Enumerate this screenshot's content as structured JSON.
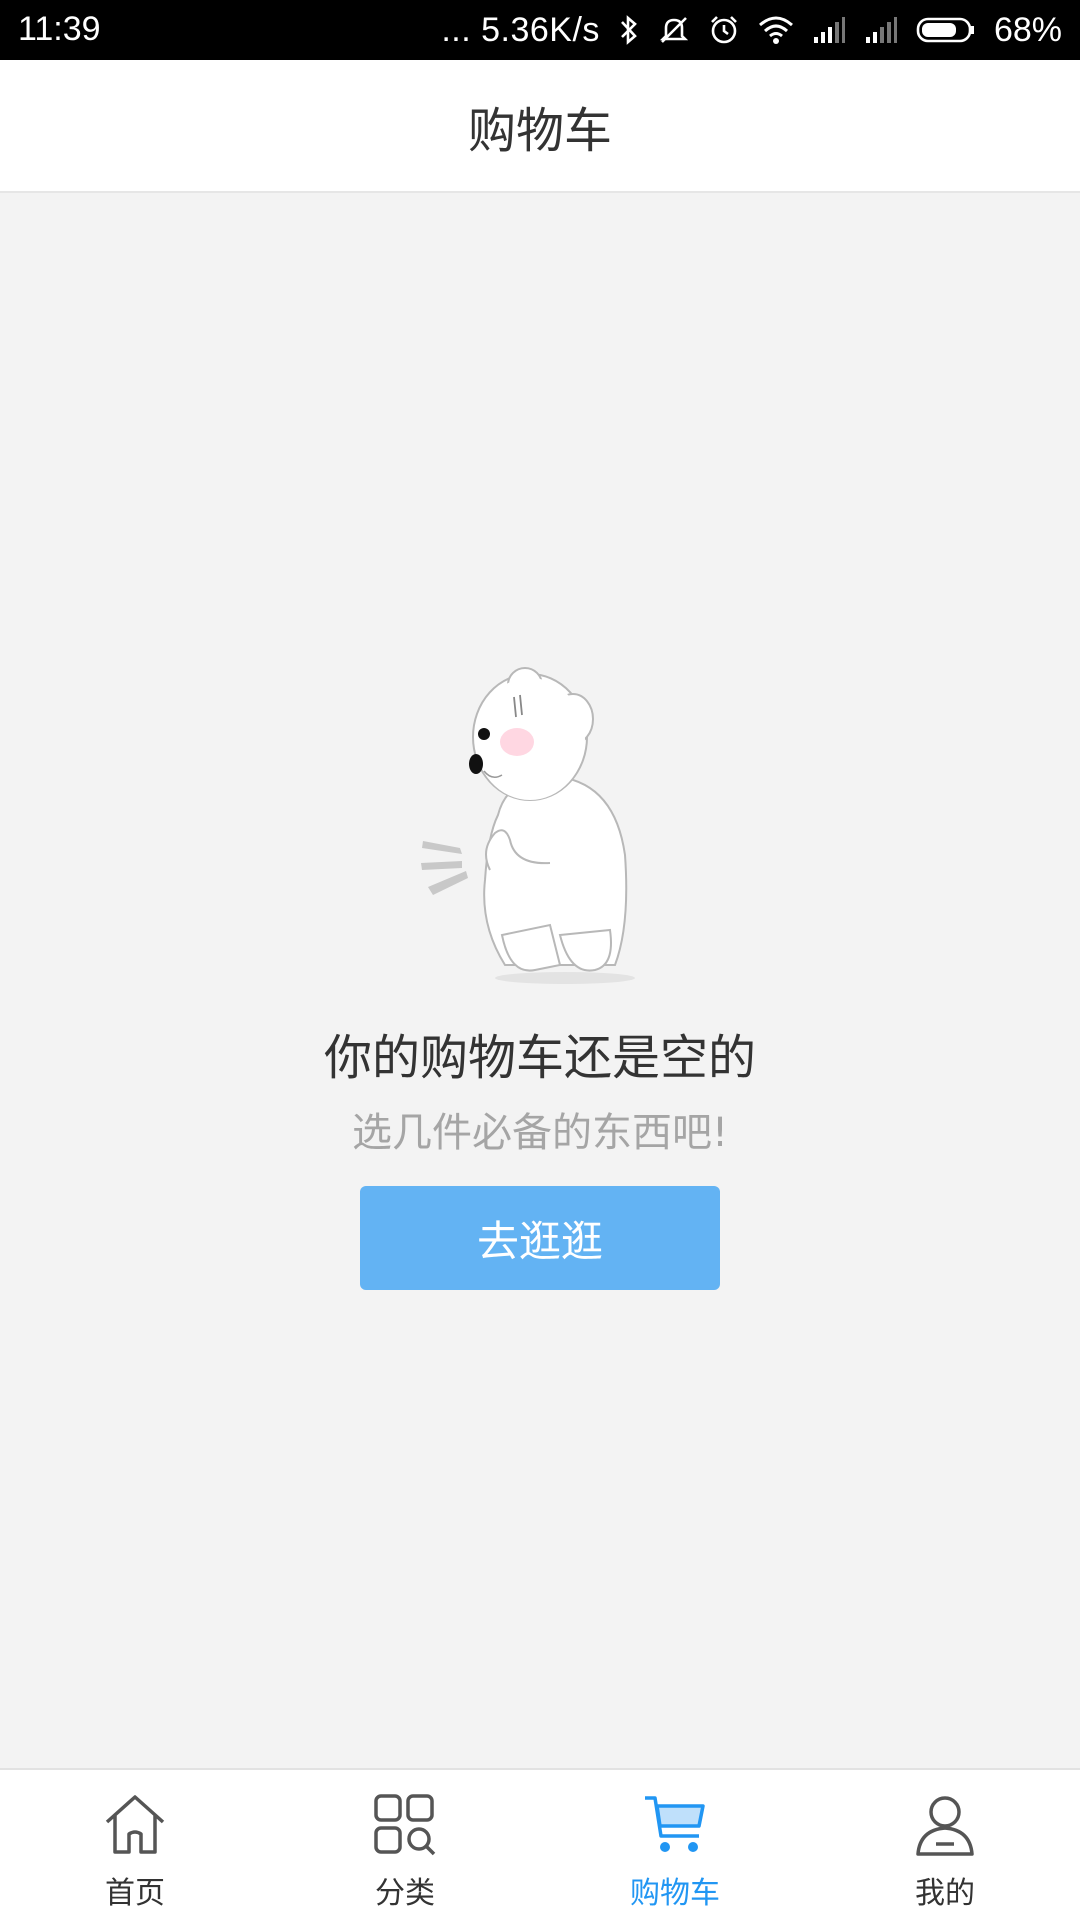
{
  "status_bar": {
    "time": "11:39",
    "net_speed": "... 5.36K/s",
    "battery": "68%",
    "icons": [
      "bluetooth-icon",
      "mute-icon",
      "alarm-icon",
      "wifi-icon",
      "signal-icon",
      "signal-icon",
      "battery-icon"
    ]
  },
  "header": {
    "title": "购物车"
  },
  "empty_state": {
    "illustration": "shy-polar-bear",
    "title": "你的购物车还是空的",
    "subtitle": "选几件必备的东西吧!",
    "button_label": "去逛逛"
  },
  "bottom_nav": {
    "items": [
      {
        "label": "首页",
        "icon": "home-icon",
        "active": false
      },
      {
        "label": "分类",
        "icon": "category-icon",
        "active": false
      },
      {
        "label": "购物车",
        "icon": "cart-icon",
        "active": true
      },
      {
        "label": "我的",
        "icon": "user-icon",
        "active": false
      }
    ]
  },
  "colors": {
    "accent": "#2196f3",
    "button": "#63b3f3",
    "background": "#f3f3f3"
  }
}
